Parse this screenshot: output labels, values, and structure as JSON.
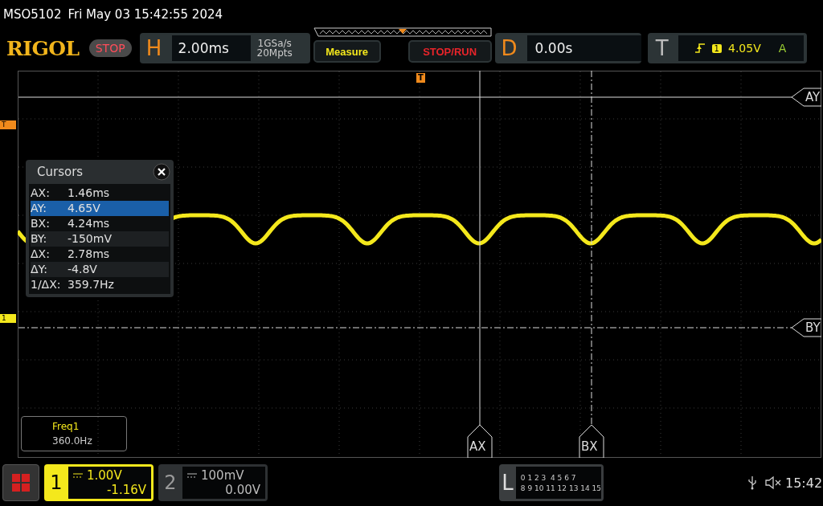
{
  "header": {
    "model": "MSO5102",
    "datetime": "Fri May 03 15:42:55 2024"
  },
  "brand": "RIGOL",
  "run_state": "STOP",
  "horizontal": {
    "label": "H",
    "timebase": "2.00ms",
    "sample_rate": "1GSa/s",
    "memory": "20Mpts"
  },
  "buttons": [
    {
      "label": "Measure",
      "kind": "measure"
    },
    {
      "label": "STOP/RUN",
      "kind": "run"
    }
  ],
  "delay": {
    "label": "D",
    "value": "0.00s"
  },
  "trigger": {
    "label": "T",
    "source": "1",
    "level": "4.05V",
    "mode": "A"
  },
  "markers": {
    "trigger_position": "T",
    "trigger_level": "T",
    "channel": "1"
  },
  "cursor_tags": [
    "AY",
    "BY",
    "AX",
    "BX"
  ],
  "cursors_panel": {
    "title": "Cursors",
    "rows": [
      {
        "label": "AX:",
        "value": "1.46ms",
        "selected": false
      },
      {
        "label": "AY:",
        "value": "4.65V",
        "selected": true
      },
      {
        "label": "BX:",
        "value": "4.24ms",
        "selected": false
      },
      {
        "label": "BY:",
        "value": "-150mV",
        "selected": false
      },
      {
        "label": "ΔX:",
        "value": "2.78ms",
        "selected": false
      },
      {
        "label": "ΔY:",
        "value": "-4.8V",
        "selected": false
      },
      {
        "label": "1/ΔX:",
        "value": "359.7Hz",
        "selected": false
      }
    ]
  },
  "measurement": {
    "name": "Freq1",
    "value": "360.0Hz"
  },
  "channels": [
    {
      "number": "1",
      "scale": "1.00V",
      "offset": "-1.16V",
      "selected": true
    },
    {
      "number": "2",
      "scale": "100mV",
      "offset": "0.00V",
      "selected": false
    }
  ],
  "logic": {
    "label": "L",
    "row_1": "0 1 2 3  4 5 6 7",
    "row_2": "8 9 10 11 12 13 14 15"
  },
  "clock": "15:42"
}
